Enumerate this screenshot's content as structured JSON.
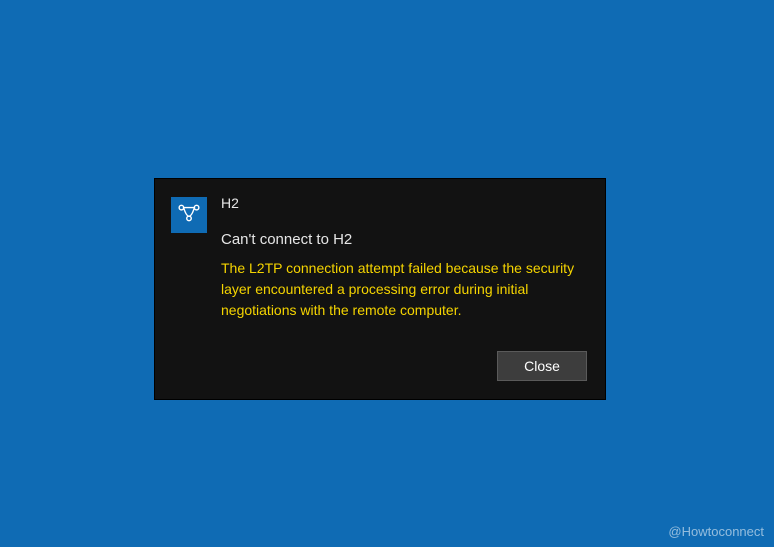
{
  "notification": {
    "title": "H2",
    "heading": "Can't connect to H2",
    "message": "The L2TP connection attempt failed because the security layer encountered a processing error during initial negotiations with the remote computer.",
    "close_label": "Close",
    "icon": "vpn-network-icon"
  },
  "watermark": "@Howtoconnect",
  "colors": {
    "background": "#0f6bb4",
    "panel": "#121212",
    "warning_text": "#f5d400"
  }
}
